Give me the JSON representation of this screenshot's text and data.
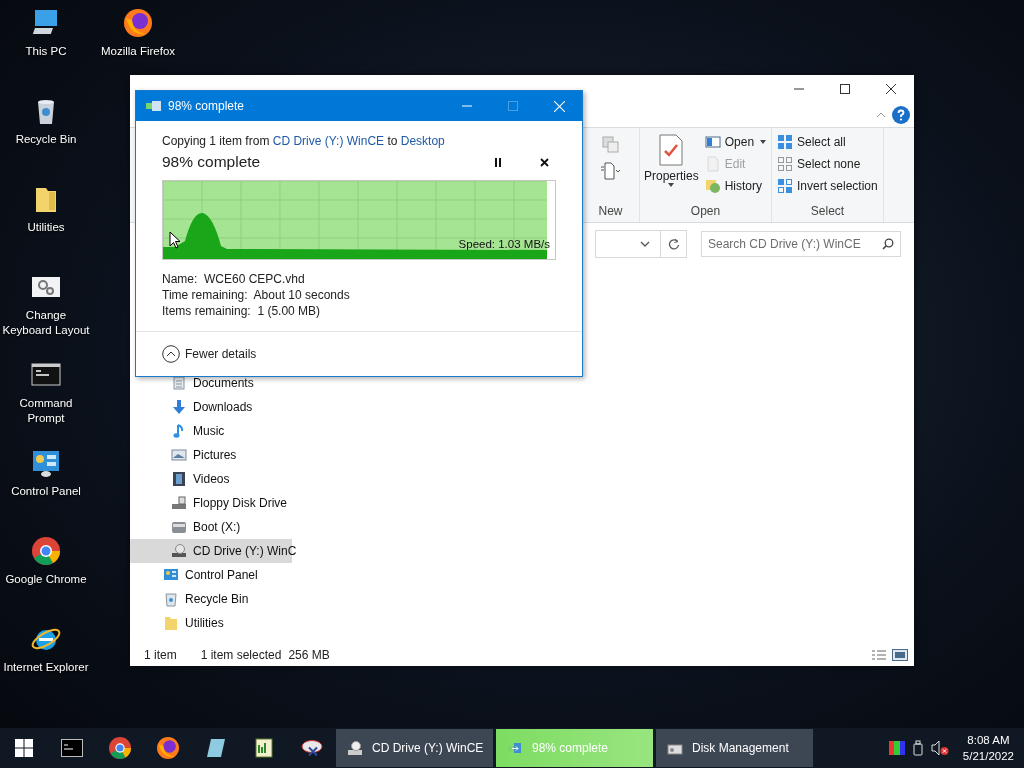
{
  "desktop_icons": [
    {
      "label": "This PC"
    },
    {
      "label": "Recycle Bin"
    },
    {
      "label": "Utilities"
    },
    {
      "label": "Change Keyboard Layout"
    },
    {
      "label": "Command Prompt"
    },
    {
      "label": "Control Panel"
    },
    {
      "label": "Google Chrome"
    },
    {
      "label": "Internet Explorer"
    },
    {
      "label": "Mozilla Firefox"
    }
  ],
  "explorer": {
    "ribbon": {
      "properties": "Properties",
      "open_buttons": [
        {
          "label": "Open",
          "disabled": false
        },
        {
          "label": "Edit",
          "disabled": true
        },
        {
          "label": "History",
          "disabled": false
        }
      ],
      "select_buttons": [
        "Select all",
        "Select none",
        "Invert selection"
      ],
      "group_labels": [
        "New",
        "Open",
        "Select"
      ]
    },
    "search": {
      "placeholder": "Search CD Drive (Y:) WinCE"
    },
    "nav_tree": [
      {
        "children": [
          {
            "label": "Documents",
            "selected": false
          },
          {
            "label": "Downloads",
            "selected": false
          },
          {
            "label": "Music",
            "selected": false
          },
          {
            "label": "Pictures",
            "selected": false
          },
          {
            "label": "Videos",
            "selected": false
          },
          {
            "label": "Floppy Disk Drive",
            "selected": false
          },
          {
            "label": "Boot (X:)",
            "selected": false
          },
          {
            "label": "CD Drive (Y:) WinC",
            "selected": true
          }
        ]
      },
      {
        "label": "Control Panel",
        "selected": false
      },
      {
        "label": "Recycle Bin",
        "selected": false
      },
      {
        "label": "Utilities",
        "selected": false
      }
    ],
    "status": {
      "count": "1 item",
      "selection": "1 item selected",
      "size": "256 MB"
    }
  },
  "dialog": {
    "title": "98% complete",
    "copy_line": {
      "prefix": "Copying 1 item from",
      "source": "CD Drive (Y:) WinCE",
      "middle": "to",
      "destination": "Desktop"
    },
    "heading": "98% complete",
    "progress": {
      "level": 0.98,
      "speed": "Speed: 1.03 MB/s"
    },
    "details": [
      {
        "label": "Name:",
        "value": "WCE60 CEPC.vhd"
      },
      {
        "label": "Time remaining:",
        "value": "About 10 seconds"
      },
      {
        "label": "Items remaining:",
        "value": "1 (5.00 MB)"
      }
    ],
    "toggle": "Fewer details"
  },
  "taskbar": {
    "tasks": [
      {
        "label": "CD Drive (Y:) WinCE",
        "selected": false
      },
      {
        "label": "98% complete",
        "selected": true
      },
      {
        "label": "Disk Management",
        "selected": false
      }
    ],
    "clock": {
      "time": "8:08 AM",
      "date": "5/21/2022"
    }
  }
}
